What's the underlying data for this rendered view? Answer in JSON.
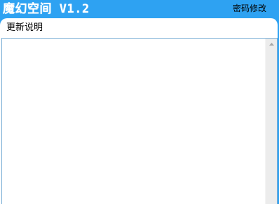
{
  "window": {
    "title": "魔幻空间 V1.2",
    "password_link": "密码修改"
  },
  "panel": {
    "heading": "更新说明",
    "content": ""
  },
  "scrollbar": {
    "up_icon": "scroll-up-arrow"
  },
  "colors": {
    "accent": "#2ea2f2",
    "panel_bg": "#ffffff",
    "textbox_border": "#7aaed6",
    "scrollbar_bg": "#ececec"
  }
}
